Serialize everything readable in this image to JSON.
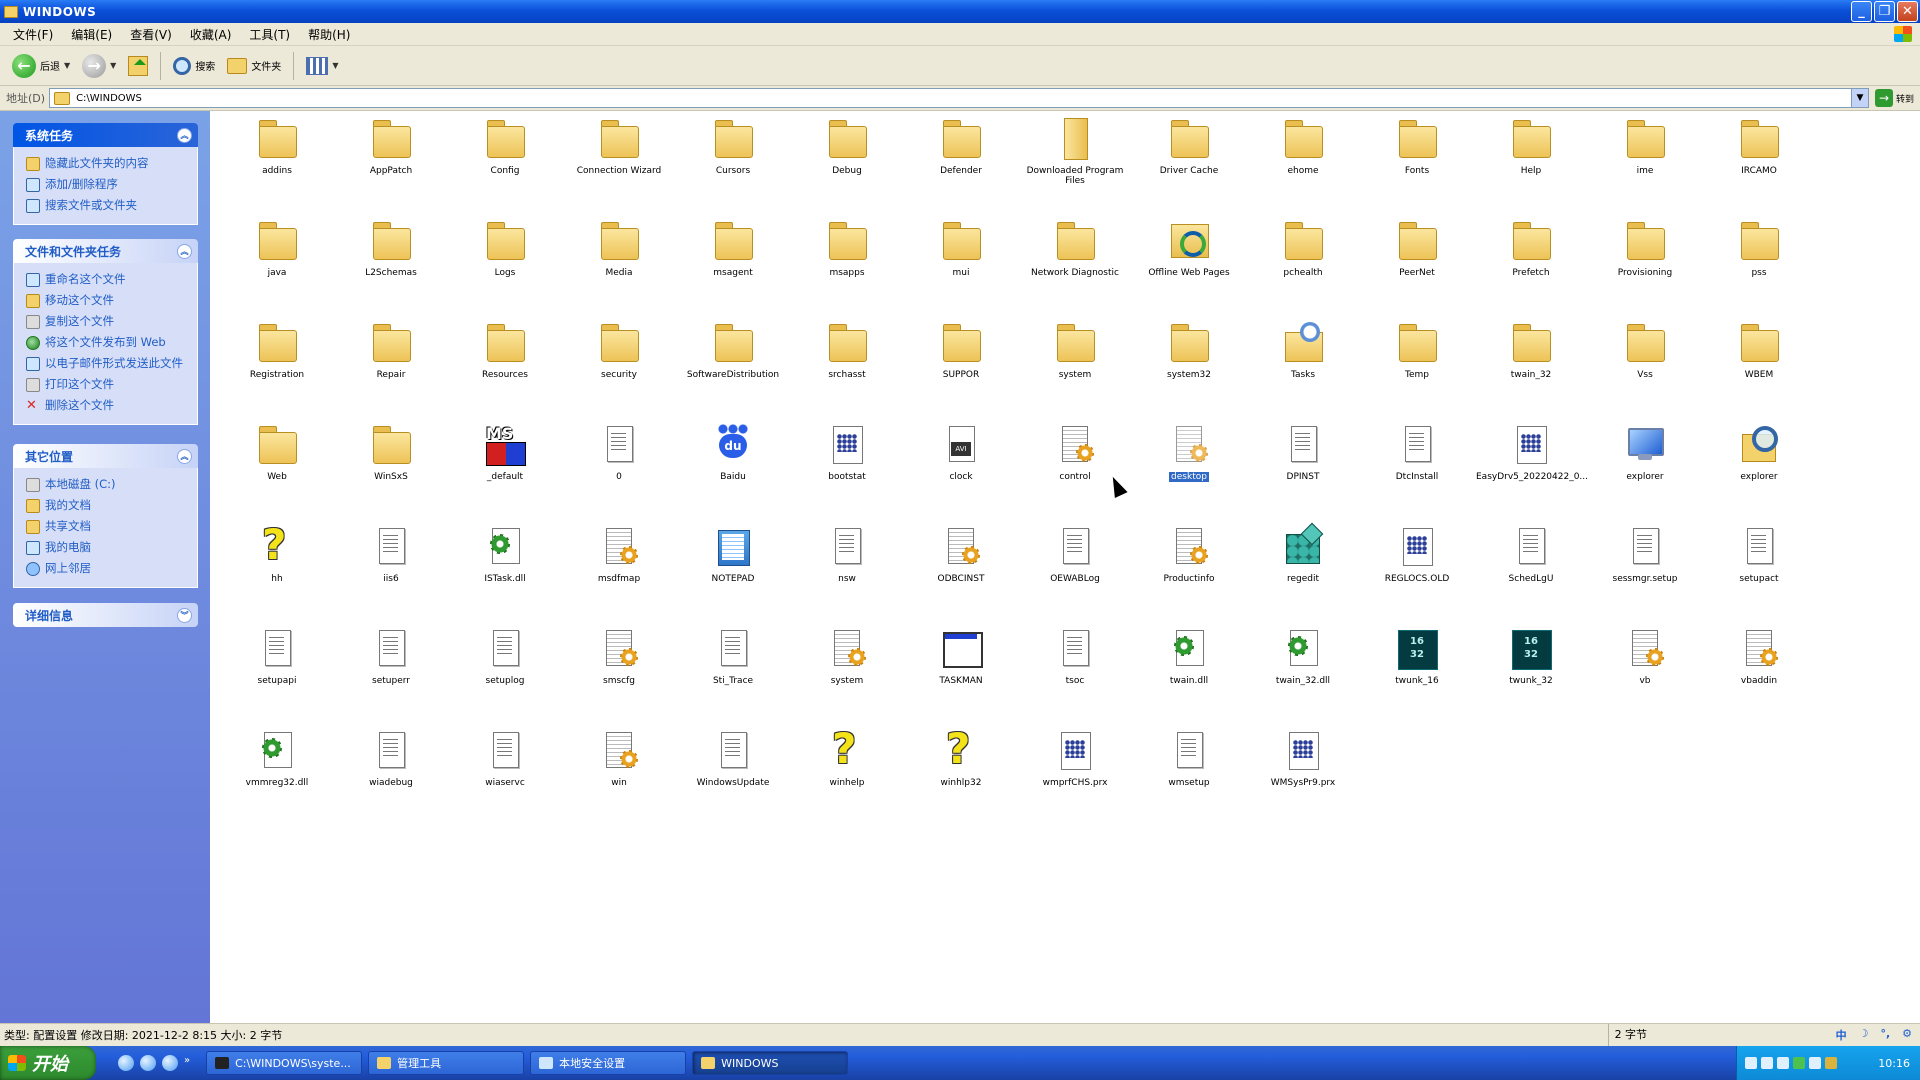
{
  "window": {
    "title": "WINDOWS"
  },
  "menu": [
    "文件(F)",
    "编辑(E)",
    "查看(V)",
    "收藏(A)",
    "工具(T)",
    "帮助(H)"
  ],
  "toolbar": {
    "back": "后退",
    "search": "搜索",
    "folders": "文件夹"
  },
  "address": {
    "label": "地址(D)",
    "path": "C:\\WINDOWS",
    "go": "转到"
  },
  "panel": {
    "system_tasks": {
      "title": "系统任务",
      "items": [
        "隐藏此文件夹的内容",
        "添加/删除程序",
        "搜索文件或文件夹"
      ]
    },
    "file_tasks": {
      "title": "文件和文件夹任务",
      "items": [
        "重命名这个文件",
        "移动这个文件",
        "复制这个文件",
        "将这个文件发布到 Web",
        "以电子邮件形式发送此文件",
        "打印这个文件",
        "删除这个文件"
      ]
    },
    "other_places": {
      "title": "其它位置",
      "items": [
        "本地磁盘 (C:)",
        "我的文档",
        "共享文档",
        "我的电脑",
        "网上邻居"
      ]
    },
    "details": {
      "title": "详细信息"
    }
  },
  "files": [
    {
      "name": "addins",
      "icon": "folder"
    },
    {
      "name": "AppPatch",
      "icon": "folder"
    },
    {
      "name": "Config",
      "icon": "folder"
    },
    {
      "name": "Connection Wizard",
      "icon": "folder"
    },
    {
      "name": "Cursors",
      "icon": "folder"
    },
    {
      "name": "Debug",
      "icon": "folder"
    },
    {
      "name": "Defender",
      "icon": "folder"
    },
    {
      "name": "Downloaded Program Files",
      "icon": "dlfolder"
    },
    {
      "name": "Driver Cache",
      "icon": "folder"
    },
    {
      "name": "ehome",
      "icon": "folder"
    },
    {
      "name": "Fonts",
      "icon": "folder"
    },
    {
      "name": "Help",
      "icon": "folder"
    },
    {
      "name": "ime",
      "icon": "folder"
    },
    {
      "name": "IRCAMO",
      "icon": "folder"
    },
    {
      "name": "java",
      "icon": "folder"
    },
    {
      "name": "L2Schemas",
      "icon": "folder"
    },
    {
      "name": "Logs",
      "icon": "folder"
    },
    {
      "name": "Media",
      "icon": "folder"
    },
    {
      "name": "msagent",
      "icon": "folder"
    },
    {
      "name": "msapps",
      "icon": "folder"
    },
    {
      "name": "mui",
      "icon": "folder"
    },
    {
      "name": "Network Diagnostic",
      "icon": "folder"
    },
    {
      "name": "Offline Web Pages",
      "icon": "webpages"
    },
    {
      "name": "pchealth",
      "icon": "folder"
    },
    {
      "name": "PeerNet",
      "icon": "folder"
    },
    {
      "name": "Prefetch",
      "icon": "folder"
    },
    {
      "name": "Provisioning",
      "icon": "folder"
    },
    {
      "name": "pss",
      "icon": "folder"
    },
    {
      "name": "Registration",
      "icon": "folder"
    },
    {
      "name": "Repair",
      "icon": "folder"
    },
    {
      "name": "Resources",
      "icon": "folder"
    },
    {
      "name": "security",
      "icon": "folder"
    },
    {
      "name": "SoftwareDistribution",
      "icon": "folder"
    },
    {
      "name": "srchasst",
      "icon": "folder"
    },
    {
      "name": "SUPPOR",
      "icon": "folder"
    },
    {
      "name": "system",
      "icon": "folder"
    },
    {
      "name": "system32",
      "icon": "folder"
    },
    {
      "name": "Tasks",
      "icon": "tasks"
    },
    {
      "name": "Temp",
      "icon": "folder"
    },
    {
      "name": "twain_32",
      "icon": "folder"
    },
    {
      "name": "Vss",
      "icon": "folder"
    },
    {
      "name": "WBEM",
      "icon": "folder"
    },
    {
      "name": "Web",
      "icon": "folder"
    },
    {
      "name": "WinSxS",
      "icon": "folder"
    },
    {
      "name": "_default",
      "icon": "msdos"
    },
    {
      "name": "0",
      "icon": "doc"
    },
    {
      "name": "Baidu",
      "icon": "paw"
    },
    {
      "name": "bootstat",
      "icon": "grid"
    },
    {
      "name": "clock",
      "icon": "avi"
    },
    {
      "name": "control",
      "icon": "cfg"
    },
    {
      "name": "desktop",
      "icon": "cfg",
      "selected": true
    },
    {
      "name": "DPINST",
      "icon": "doc"
    },
    {
      "name": "DtcInstall",
      "icon": "doc"
    },
    {
      "name": "EasyDrv5_20220422_0...",
      "icon": "grid"
    },
    {
      "name": "explorer",
      "icon": "monitor"
    },
    {
      "name": "explorer",
      "icon": "mag"
    },
    {
      "name": "hh",
      "icon": "help"
    },
    {
      "name": "iis6",
      "icon": "doc"
    },
    {
      "name": "ISTask.dll",
      "icon": "dll"
    },
    {
      "name": "msdfmap",
      "icon": "cfg"
    },
    {
      "name": "NOTEPAD",
      "icon": "notepad"
    },
    {
      "name": "nsw",
      "icon": "doc"
    },
    {
      "name": "ODBCINST",
      "icon": "cfg"
    },
    {
      "name": "OEWABLog",
      "icon": "doc"
    },
    {
      "name": "Productinfo",
      "icon": "cfg"
    },
    {
      "name": "regedit",
      "icon": "regedit"
    },
    {
      "name": "REGLOCS.OLD",
      "icon": "grid"
    },
    {
      "name": "SchedLgU",
      "icon": "doc"
    },
    {
      "name": "sessmgr.setup",
      "icon": "doc"
    },
    {
      "name": "setupact",
      "icon": "doc"
    },
    {
      "name": "setupapi",
      "icon": "doc"
    },
    {
      "name": "setuperr",
      "icon": "doc"
    },
    {
      "name": "setuplog",
      "icon": "doc"
    },
    {
      "name": "smscfg",
      "icon": "cfg"
    },
    {
      "name": "Sti_Trace",
      "icon": "doc"
    },
    {
      "name": "system",
      "icon": "cfg"
    },
    {
      "name": "TASKMAN",
      "icon": "window"
    },
    {
      "name": "tsoc",
      "icon": "doc"
    },
    {
      "name": "twain.dll",
      "icon": "dll"
    },
    {
      "name": "twain_32.dll",
      "icon": "dll"
    },
    {
      "name": "twunk_16",
      "icon": "win16"
    },
    {
      "name": "twunk_32",
      "icon": "win16"
    },
    {
      "name": "vb",
      "icon": "cfg"
    },
    {
      "name": "vbaddin",
      "icon": "cfg"
    },
    {
      "name": "vmmreg32.dll",
      "icon": "dll"
    },
    {
      "name": "wiadebug",
      "icon": "doc"
    },
    {
      "name": "wiaservc",
      "icon": "doc"
    },
    {
      "name": "win",
      "icon": "cfg"
    },
    {
      "name": "WindowsUpdate",
      "icon": "doc"
    },
    {
      "name": "winhelp",
      "icon": "help"
    },
    {
      "name": "winhlp32",
      "icon": "help"
    },
    {
      "name": "wmprfCHS.prx",
      "icon": "grid"
    },
    {
      "name": "wmsetup",
      "icon": "doc"
    },
    {
      "name": "WMSysPr9.prx",
      "icon": "grid"
    }
  ],
  "status": {
    "info": "类型: 配置设置 修改日期: 2021-12-2 8:15 大小: 2 字节",
    "size": "2 字节",
    "ime": [
      "中",
      "☽",
      "°,",
      "⚙"
    ]
  },
  "taskbar": {
    "start": "开始",
    "tasks": [
      {
        "label": "C:\\WINDOWS\\syste...",
        "color": "#222"
      },
      {
        "label": "管理工具",
        "color": "#f3d26b"
      },
      {
        "label": "本地安全设置",
        "color": "#cfe6ff"
      },
      {
        "label": "WINDOWS",
        "color": "#f3d26b",
        "active": true
      }
    ],
    "clock": "10:16"
  }
}
